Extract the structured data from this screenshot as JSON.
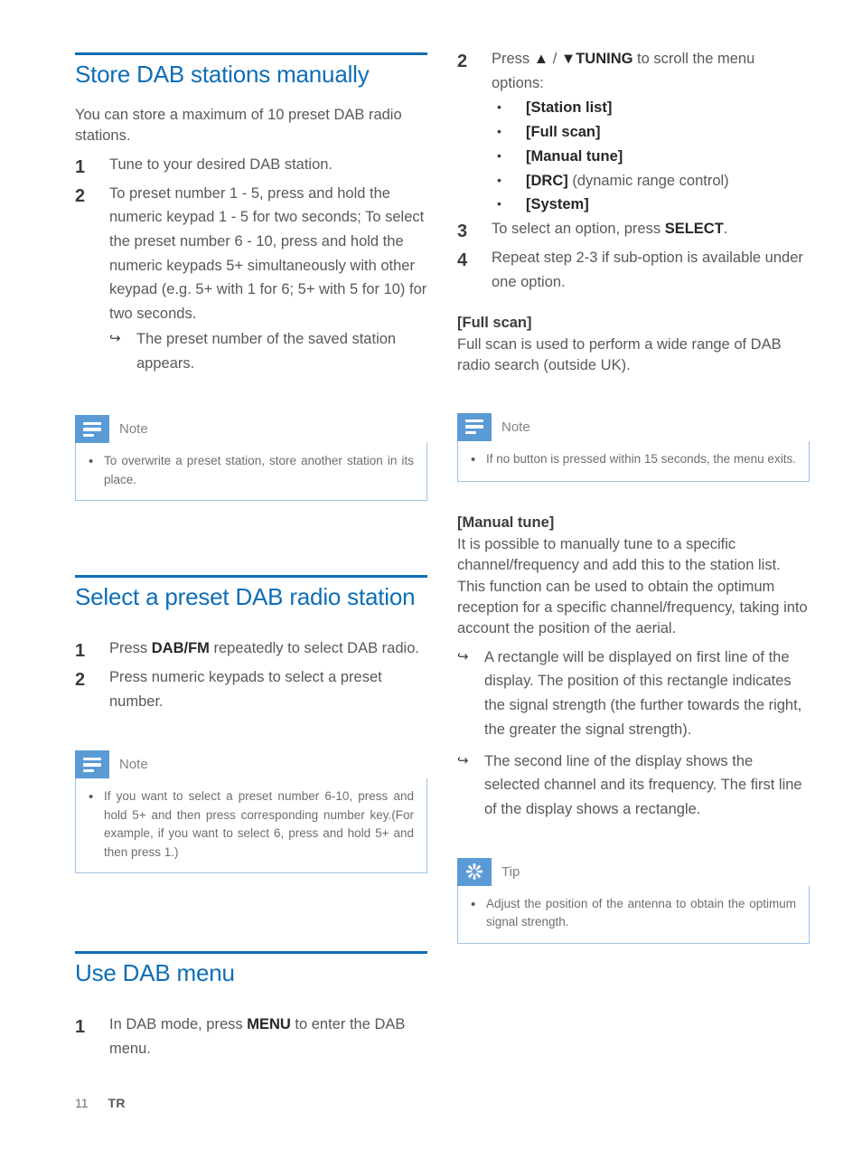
{
  "page": {
    "number": "11",
    "language": "TR"
  },
  "colors": {
    "heading_blue": "#0f6eb5",
    "callout_icon_blue": "#5b9bd5",
    "callout_border_blue": "#9cc3e5",
    "body_text": "#58595b"
  },
  "left_column": {
    "section1": {
      "heading": "Store DAB stations manually",
      "intro": "You can store a maximum of 10 preset DAB radio stations.",
      "steps": [
        {
          "num": "1",
          "text": "Tune to your desired DAB station."
        },
        {
          "num": "2",
          "text": "To preset number 1 - 5, press and hold the numeric keypad 1 - 5 for two seconds; To select the preset number 6 - 10, press and hold the numeric keypads 5+ simultaneously with other keypad (e.g. 5+ with 1 for 6; 5+ with 5 for 10) for two seconds.",
          "arrow_items": [
            "The preset number of the saved station appears."
          ]
        }
      ],
      "note": {
        "icon": "note-lines-icon",
        "title": "Note",
        "bullets": [
          "To overwrite a preset station, store another station in its place."
        ]
      }
    },
    "section2": {
      "heading": "Select a preset DAB radio station",
      "steps": [
        {
          "num": "1",
          "text_before": "Press ",
          "bold": "DAB/FM",
          "text_after": " repeatedly to select DAB radio."
        },
        {
          "num": "2",
          "text": "Press numeric keypads to select a preset number."
        }
      ],
      "note": {
        "icon": "note-lines-icon",
        "title": "Note",
        "bullets": [
          "If you want to select a preset number 6-10, press and hold 5+ and then press corresponding number key.(For example, if you want to select 6, press and hold 5+ and then press 1.)"
        ]
      }
    },
    "section3": {
      "heading": "Use DAB menu",
      "steps": [
        {
          "num": "1",
          "text_before": "In DAB mode, press ",
          "bold": "MENU",
          "text_after": " to enter the DAB menu."
        }
      ]
    }
  },
  "right_column": {
    "step2": {
      "num": "2",
      "text_before": "Press ",
      "arrow_up": "▲",
      "separator": " / ",
      "arrow_down": "▼",
      "bold": "TUNING",
      "text_after": " to scroll the menu options:",
      "options": [
        {
          "label": "[Station list]",
          "suffix": ""
        },
        {
          "label": "[Full scan]",
          "suffix": ""
        },
        {
          "label": "[Manual tune]",
          "suffix": ""
        },
        {
          "label": "[DRC]",
          "suffix": " (dynamic range control)"
        },
        {
          "label": "[System]",
          "suffix": ""
        }
      ]
    },
    "step3": {
      "num": "3",
      "text_before": "To select an option, press ",
      "bold": "SELECT",
      "text_after": "."
    },
    "step4": {
      "num": "4",
      "text": "Repeat step 2-3 if sub-option is available under one option."
    },
    "full_scan": {
      "subhead": "[Full scan]",
      "body": "Full scan is used to perform a wide range of DAB radio search (outside UK)."
    },
    "note": {
      "icon": "note-lines-icon",
      "title": "Note",
      "bullets": [
        "If no button is pressed within 15 seconds, the menu exits."
      ]
    },
    "manual_tune": {
      "subhead": "[Manual tune]",
      "paragraphs": [
        "It is possible to manually tune to a specific channel/frequency and add this to the station list.",
        "This function can be used to obtain the optimum reception for a specific channel/frequency, taking into account the position of the aerial."
      ],
      "arrow_items": [
        "A rectangle will be displayed on first line of the display. The position of this rectangle indicates the signal strength (the further towards the right, the greater the signal strength).",
        "The second line of the display shows the selected channel and its frequency. The first line of the display shows a rectangle."
      ]
    },
    "tip": {
      "icon": "asterisk-starburst-icon",
      "title": "Tip",
      "bullets": [
        "Adjust the position of the antenna to obtain the optimum signal strength."
      ]
    }
  }
}
